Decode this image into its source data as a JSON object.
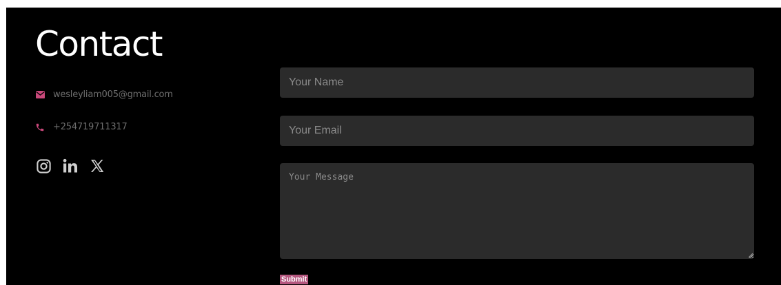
{
  "section": {
    "title": "Contact"
  },
  "contact_info": {
    "email": "wesleyliam005@gmail.com",
    "phone": "+254719711317",
    "icons": {
      "email": "envelope-icon",
      "phone": "phone-icon"
    }
  },
  "socials": [
    {
      "name": "instagram-icon"
    },
    {
      "name": "linkedin-icon"
    },
    {
      "name": "x-twitter-icon"
    }
  ],
  "form": {
    "name_placeholder": "Your Name",
    "email_placeholder": "Your Email",
    "message_placeholder": "Your Message",
    "name_value": "",
    "email_value": "",
    "message_value": "",
    "submit_label": "Submit"
  },
  "colors": {
    "background": "#000000",
    "accent": "#b5577f",
    "field_background": "#2b2b2b",
    "text_primary": "#ffffff",
    "text_muted": "#6e6e6e",
    "social_icon": "#cfcfcf"
  }
}
